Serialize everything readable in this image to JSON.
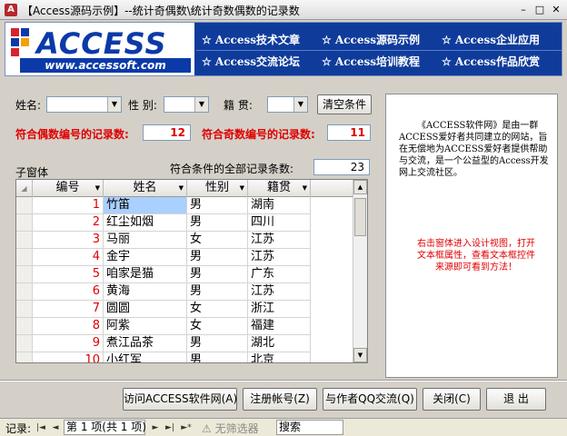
{
  "window": {
    "title": "【Access源码示例】--统计奇偶数\\统计奇数偶数的记录数",
    "minimize": "–",
    "maximize": "□",
    "close": "✕"
  },
  "banner": {
    "logo_text": "ACCESS",
    "logo_url": "www.accessoft.com",
    "nav": [
      "☆ Access技术文章",
      "☆ Access源码示例",
      "☆ Access企业应用",
      "☆ Access交流论坛",
      "☆ Access培训教程",
      "☆ Access作品欣赏"
    ]
  },
  "filters": {
    "name_label": "姓名:",
    "gender_label": "性 别:",
    "origin_label": "籍 贯:",
    "name_value": "",
    "gender_value": "",
    "origin_value": "",
    "clear_button": "清空条件"
  },
  "counts": {
    "even_label": "符合偶数编号的记录数:",
    "even_value": "12",
    "odd_label": "符合奇数编号的记录数:",
    "odd_value": "11",
    "total_label": "符合条件的全部记录条数:",
    "total_value": "23",
    "subform_label": "子窗体"
  },
  "grid": {
    "columns": [
      "编号",
      "姓名",
      "性别",
      "籍贯"
    ],
    "rows": [
      [
        "1",
        "竹笛",
        "男",
        "湖南"
      ],
      [
        "2",
        "红尘如烟",
        "男",
        "四川"
      ],
      [
        "3",
        "马丽",
        "女",
        "江苏"
      ],
      [
        "4",
        "金宇",
        "男",
        "江苏"
      ],
      [
        "5",
        "咱家是猫",
        "男",
        "广东"
      ],
      [
        "6",
        "黄海",
        "男",
        "江苏"
      ],
      [
        "7",
        "圆圆",
        "女",
        "浙江"
      ],
      [
        "8",
        "阿紫",
        "女",
        "福建"
      ],
      [
        "9",
        "煮江品茶",
        "男",
        "湖北"
      ],
      [
        "10",
        "小红军",
        "男",
        "北京"
      ]
    ]
  },
  "side": {
    "intro": "《ACCESS软件网》是由一群ACCESS爱好者共同建立的网站，旨在无偿地为ACCESS爱好者提供帮助与交流，是一个公益型的Access开发网上交流社区。",
    "hint": "右击窗体进入设计视图，打开文本框属性，查看文本框控件来源即可看到方法！"
  },
  "buttons": {
    "visit": "访问ACCESS软件网(A)",
    "register": "注册帐号(Z)",
    "qq": "与作者QQ交流(Q)",
    "close": "关闭(C)",
    "exit": "退 出"
  },
  "navbar": {
    "record_label": "记录:",
    "first": "|◄",
    "prev": "◄",
    "position": "第 1 项(共 1 项)",
    "next": "►",
    "last": "►|",
    "new": "►*",
    "filter": "无筛选器",
    "search": "搜索"
  },
  "colors": {
    "banner_bg": "#0f3c9b",
    "accent_red": "#e00000",
    "selection": "#aad0ff"
  }
}
